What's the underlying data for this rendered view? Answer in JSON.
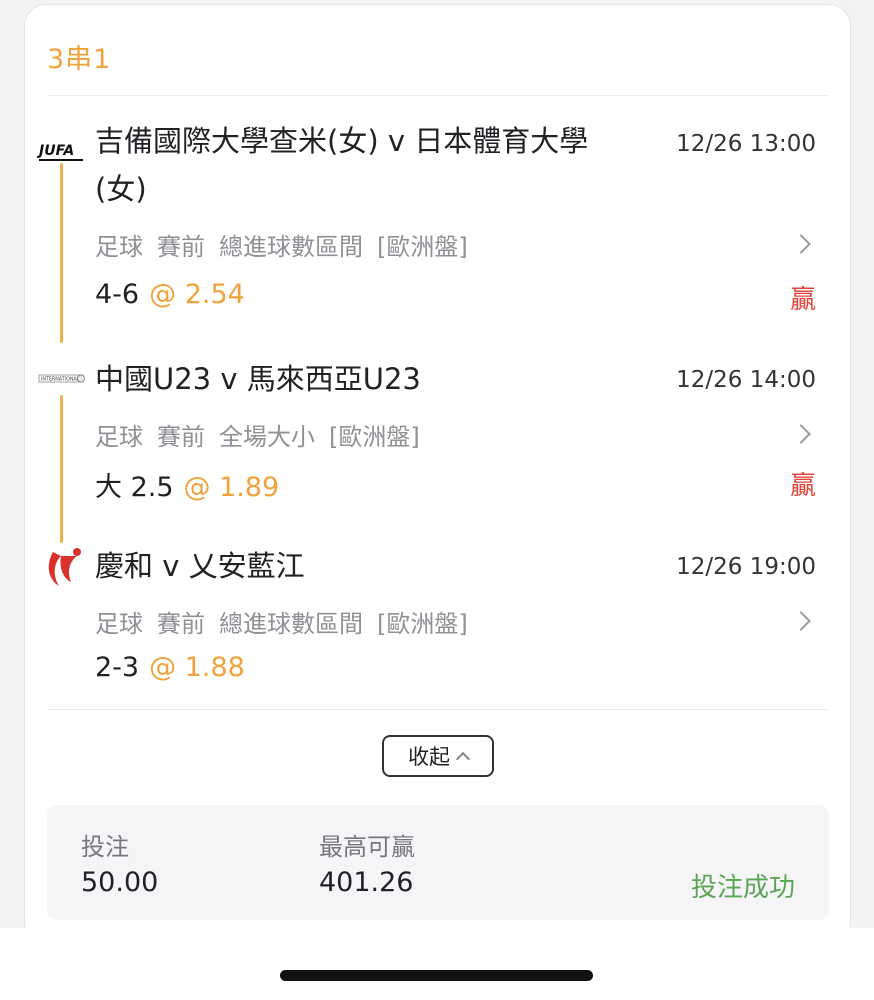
{
  "parlay": {
    "title": "3串1"
  },
  "legs": [
    {
      "teams": "吉備國際大學查米(女) v 日本體育大學(女)",
      "time": "12/26 13:00",
      "sport": "足球",
      "stage": "賽前",
      "market": "總進球數區間",
      "odds_type": "[歐洲盤]",
      "selection": "4-6",
      "odds": "@ 2.54",
      "result": "贏",
      "logo_text": "JUFA",
      "logo_icon": "jufa-logo-icon"
    },
    {
      "teams": "中國U23 v 馬來西亞U23",
      "time": "12/26 14:00",
      "sport": "足球",
      "stage": "賽前",
      "market": "全場大小",
      "odds_type": "[歐洲盤]",
      "selection": "大 2.5",
      "odds": "@ 1.89",
      "result": "贏",
      "logo_text": "INTERNATIONAL",
      "logo_icon": "international-logo-icon"
    },
    {
      "teams": "慶和 v 乂安藍江",
      "time": "12/26 19:00",
      "sport": "足球",
      "stage": "賽前",
      "market": "總進球數區間",
      "odds_type": "[歐洲盤]",
      "selection": "2-3",
      "odds": "@ 1.88",
      "result": "",
      "logo_icon": "club-logo-icon"
    }
  ],
  "collapse_label": "收起",
  "summary": {
    "stake_label": "投注",
    "stake_value": "50.00",
    "max_win_label": "最高可贏",
    "max_win_value": "401.26",
    "status": "投注成功"
  },
  "colors": {
    "accent": "#f0a23c",
    "win": "#e0443b",
    "success": "#59a653"
  }
}
